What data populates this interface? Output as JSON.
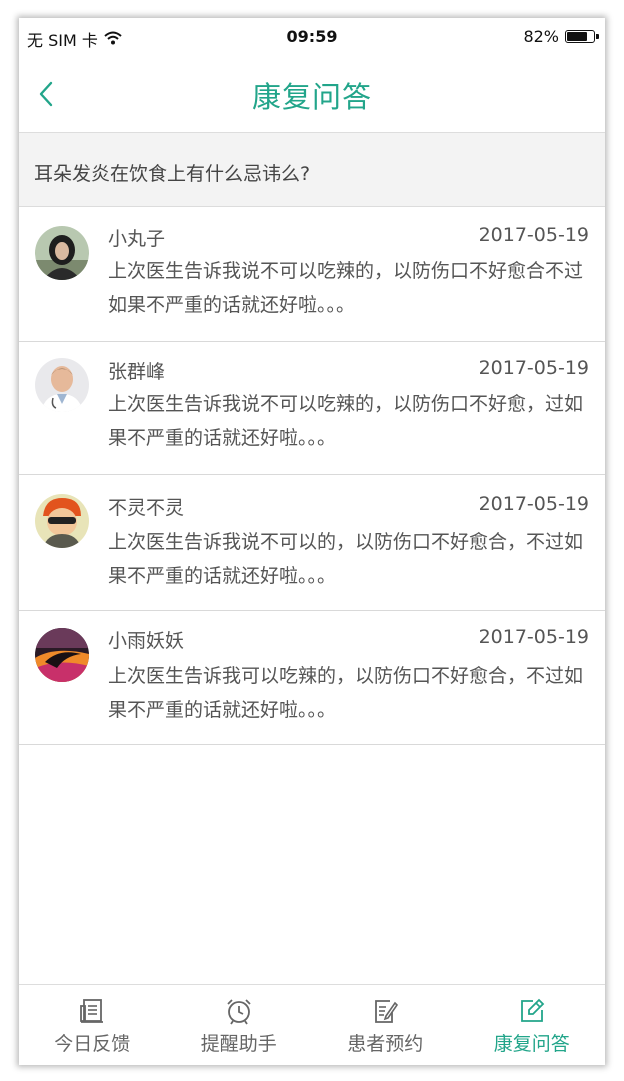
{
  "status_bar": {
    "carrier": "无 SIM 卡",
    "time": "09:59",
    "battery_text": "82%",
    "battery_level": 0.82
  },
  "nav": {
    "title": "康复问答",
    "back_icon": "chevron-left-icon",
    "accent_color": "#22a58a"
  },
  "question": {
    "text": "耳朵发炎在饮食上有什么忌讳么?"
  },
  "answers": [
    {
      "author": "小丸子",
      "date": "2017-05-19",
      "content": "上次医生告诉我说不可以吃辣的，以防伤口不好愈合不过如果不严重的话就还好啦。。。"
    },
    {
      "author": "张群峰",
      "date": "2017-05-19",
      "content": "上次医生告诉我说不可以吃辣的，以防伤口不好愈，过如果不严重的话就还好啦。。。"
    },
    {
      "author": "不灵不灵",
      "date": "2017-05-19",
      "content": "上次医生告诉我说不可以的，以防伤口不好愈合，不过如果不严重的话就还好啦。。。"
    },
    {
      "author": "小雨妖妖",
      "date": "2017-05-19",
      "content": "上次医生告诉我可以吃辣的，以防伤口不好愈合，不过如果不严重的话就还好啦。。。"
    }
  ],
  "tabbar": {
    "items": [
      {
        "label": "今日反馈",
        "icon": "document-icon",
        "active": false
      },
      {
        "label": "提醒助手",
        "icon": "alarm-clock-icon",
        "active": false
      },
      {
        "label": "患者预约",
        "icon": "clipboard-edit-icon",
        "active": false
      },
      {
        "label": "康复问答",
        "icon": "edit-square-icon",
        "active": true
      }
    ]
  }
}
